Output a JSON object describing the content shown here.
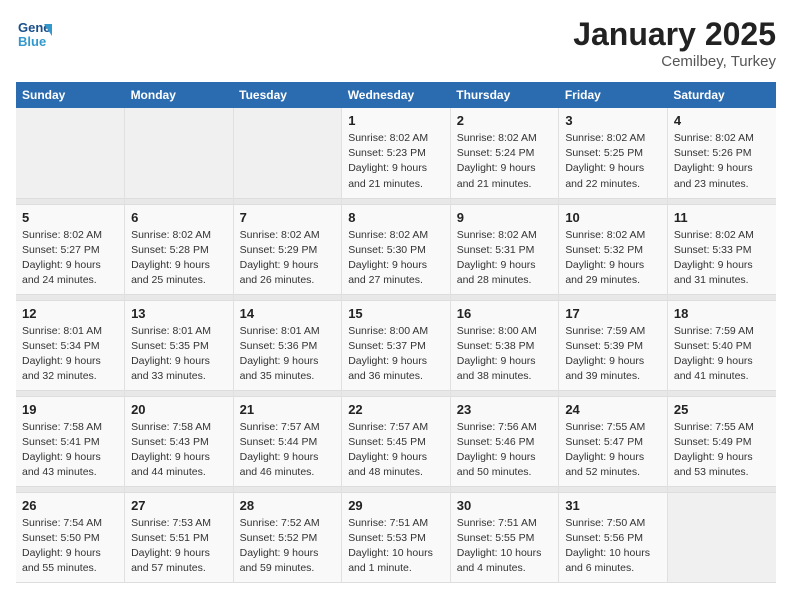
{
  "header": {
    "logo_line1": "General",
    "logo_line2": "Blue",
    "month": "January 2025",
    "location": "Cemilbey, Turkey"
  },
  "days_of_week": [
    "Sunday",
    "Monday",
    "Tuesday",
    "Wednesday",
    "Thursday",
    "Friday",
    "Saturday"
  ],
  "weeks": [
    [
      {
        "num": "",
        "empty": true
      },
      {
        "num": "",
        "empty": true
      },
      {
        "num": "",
        "empty": true
      },
      {
        "num": "1",
        "sunrise": "8:02 AM",
        "sunset": "5:23 PM",
        "daylight": "9 hours and 21 minutes."
      },
      {
        "num": "2",
        "sunrise": "8:02 AM",
        "sunset": "5:24 PM",
        "daylight": "9 hours and 21 minutes."
      },
      {
        "num": "3",
        "sunrise": "8:02 AM",
        "sunset": "5:25 PM",
        "daylight": "9 hours and 22 minutes."
      },
      {
        "num": "4",
        "sunrise": "8:02 AM",
        "sunset": "5:26 PM",
        "daylight": "9 hours and 23 minutes."
      }
    ],
    [
      {
        "num": "5",
        "sunrise": "8:02 AM",
        "sunset": "5:27 PM",
        "daylight": "9 hours and 24 minutes."
      },
      {
        "num": "6",
        "sunrise": "8:02 AM",
        "sunset": "5:28 PM",
        "daylight": "9 hours and 25 minutes."
      },
      {
        "num": "7",
        "sunrise": "8:02 AM",
        "sunset": "5:29 PM",
        "daylight": "9 hours and 26 minutes."
      },
      {
        "num": "8",
        "sunrise": "8:02 AM",
        "sunset": "5:30 PM",
        "daylight": "9 hours and 27 minutes."
      },
      {
        "num": "9",
        "sunrise": "8:02 AM",
        "sunset": "5:31 PM",
        "daylight": "9 hours and 28 minutes."
      },
      {
        "num": "10",
        "sunrise": "8:02 AM",
        "sunset": "5:32 PM",
        "daylight": "9 hours and 29 minutes."
      },
      {
        "num": "11",
        "sunrise": "8:02 AM",
        "sunset": "5:33 PM",
        "daylight": "9 hours and 31 minutes."
      }
    ],
    [
      {
        "num": "12",
        "sunrise": "8:01 AM",
        "sunset": "5:34 PM",
        "daylight": "9 hours and 32 minutes."
      },
      {
        "num": "13",
        "sunrise": "8:01 AM",
        "sunset": "5:35 PM",
        "daylight": "9 hours and 33 minutes."
      },
      {
        "num": "14",
        "sunrise": "8:01 AM",
        "sunset": "5:36 PM",
        "daylight": "9 hours and 35 minutes."
      },
      {
        "num": "15",
        "sunrise": "8:00 AM",
        "sunset": "5:37 PM",
        "daylight": "9 hours and 36 minutes."
      },
      {
        "num": "16",
        "sunrise": "8:00 AM",
        "sunset": "5:38 PM",
        "daylight": "9 hours and 38 minutes."
      },
      {
        "num": "17",
        "sunrise": "7:59 AM",
        "sunset": "5:39 PM",
        "daylight": "9 hours and 39 minutes."
      },
      {
        "num": "18",
        "sunrise": "7:59 AM",
        "sunset": "5:40 PM",
        "daylight": "9 hours and 41 minutes."
      }
    ],
    [
      {
        "num": "19",
        "sunrise": "7:58 AM",
        "sunset": "5:41 PM",
        "daylight": "9 hours and 43 minutes."
      },
      {
        "num": "20",
        "sunrise": "7:58 AM",
        "sunset": "5:43 PM",
        "daylight": "9 hours and 44 minutes."
      },
      {
        "num": "21",
        "sunrise": "7:57 AM",
        "sunset": "5:44 PM",
        "daylight": "9 hours and 46 minutes."
      },
      {
        "num": "22",
        "sunrise": "7:57 AM",
        "sunset": "5:45 PM",
        "daylight": "9 hours and 48 minutes."
      },
      {
        "num": "23",
        "sunrise": "7:56 AM",
        "sunset": "5:46 PM",
        "daylight": "9 hours and 50 minutes."
      },
      {
        "num": "24",
        "sunrise": "7:55 AM",
        "sunset": "5:47 PM",
        "daylight": "9 hours and 52 minutes."
      },
      {
        "num": "25",
        "sunrise": "7:55 AM",
        "sunset": "5:49 PM",
        "daylight": "9 hours and 53 minutes."
      }
    ],
    [
      {
        "num": "26",
        "sunrise": "7:54 AM",
        "sunset": "5:50 PM",
        "daylight": "9 hours and 55 minutes."
      },
      {
        "num": "27",
        "sunrise": "7:53 AM",
        "sunset": "5:51 PM",
        "daylight": "9 hours and 57 minutes."
      },
      {
        "num": "28",
        "sunrise": "7:52 AM",
        "sunset": "5:52 PM",
        "daylight": "9 hours and 59 minutes."
      },
      {
        "num": "29",
        "sunrise": "7:51 AM",
        "sunset": "5:53 PM",
        "daylight": "10 hours and 1 minute."
      },
      {
        "num": "30",
        "sunrise": "7:51 AM",
        "sunset": "5:55 PM",
        "daylight": "10 hours and 4 minutes."
      },
      {
        "num": "31",
        "sunrise": "7:50 AM",
        "sunset": "5:56 PM",
        "daylight": "10 hours and 6 minutes."
      },
      {
        "num": "",
        "empty": true
      }
    ]
  ]
}
